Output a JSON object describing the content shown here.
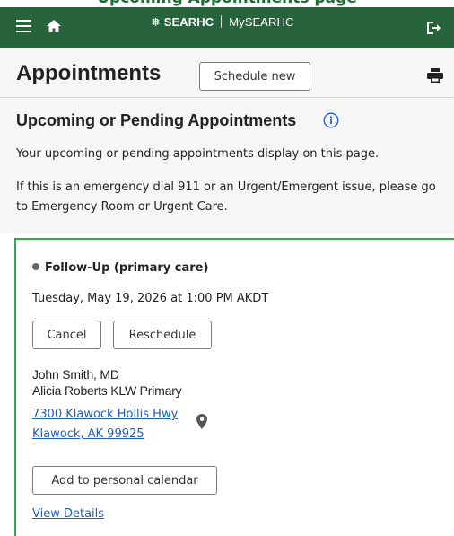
{
  "page_heading_cut": "Upcoming Appointments page",
  "header": {
    "brand_logo": "SEARHC",
    "brand_app": "MySEARHC",
    "icons": [
      "menu-icon",
      "home-icon",
      "logout-icon"
    ],
    "color": "#28643b"
  },
  "page": {
    "title": "Appointments",
    "schedule_label": "Schedule new",
    "print_icon": "print-icon"
  },
  "upcoming": {
    "title": "Upcoming or Pending Appointments",
    "info_icon": "info-icon",
    "description": "Your upcoming or pending appointments display on this page.",
    "emergency_note": "If this is an emergency dial 911 or an Urgent/Emergent issue, please go to Emergency Room or Urgent Care."
  },
  "appointment": {
    "type": "Follow-Up (primary care)",
    "datetime": "Tuesday, May 19, 2026 at 1:00 PM AKDT",
    "cancel_label": "Cancel",
    "reschedule_label": "Reschedule",
    "provider": "John Smith, MD",
    "clinic": "Alicia Roberts KLW Primary",
    "address_line1": "7300 Klawock Hollis Hwy",
    "address_line2": "Klawock, AK 99925",
    "calendar_label": "Add to personal calendar",
    "details_label": "View Details",
    "accent_color": "#2fa84f",
    "link_color": "#1f5fb8"
  }
}
